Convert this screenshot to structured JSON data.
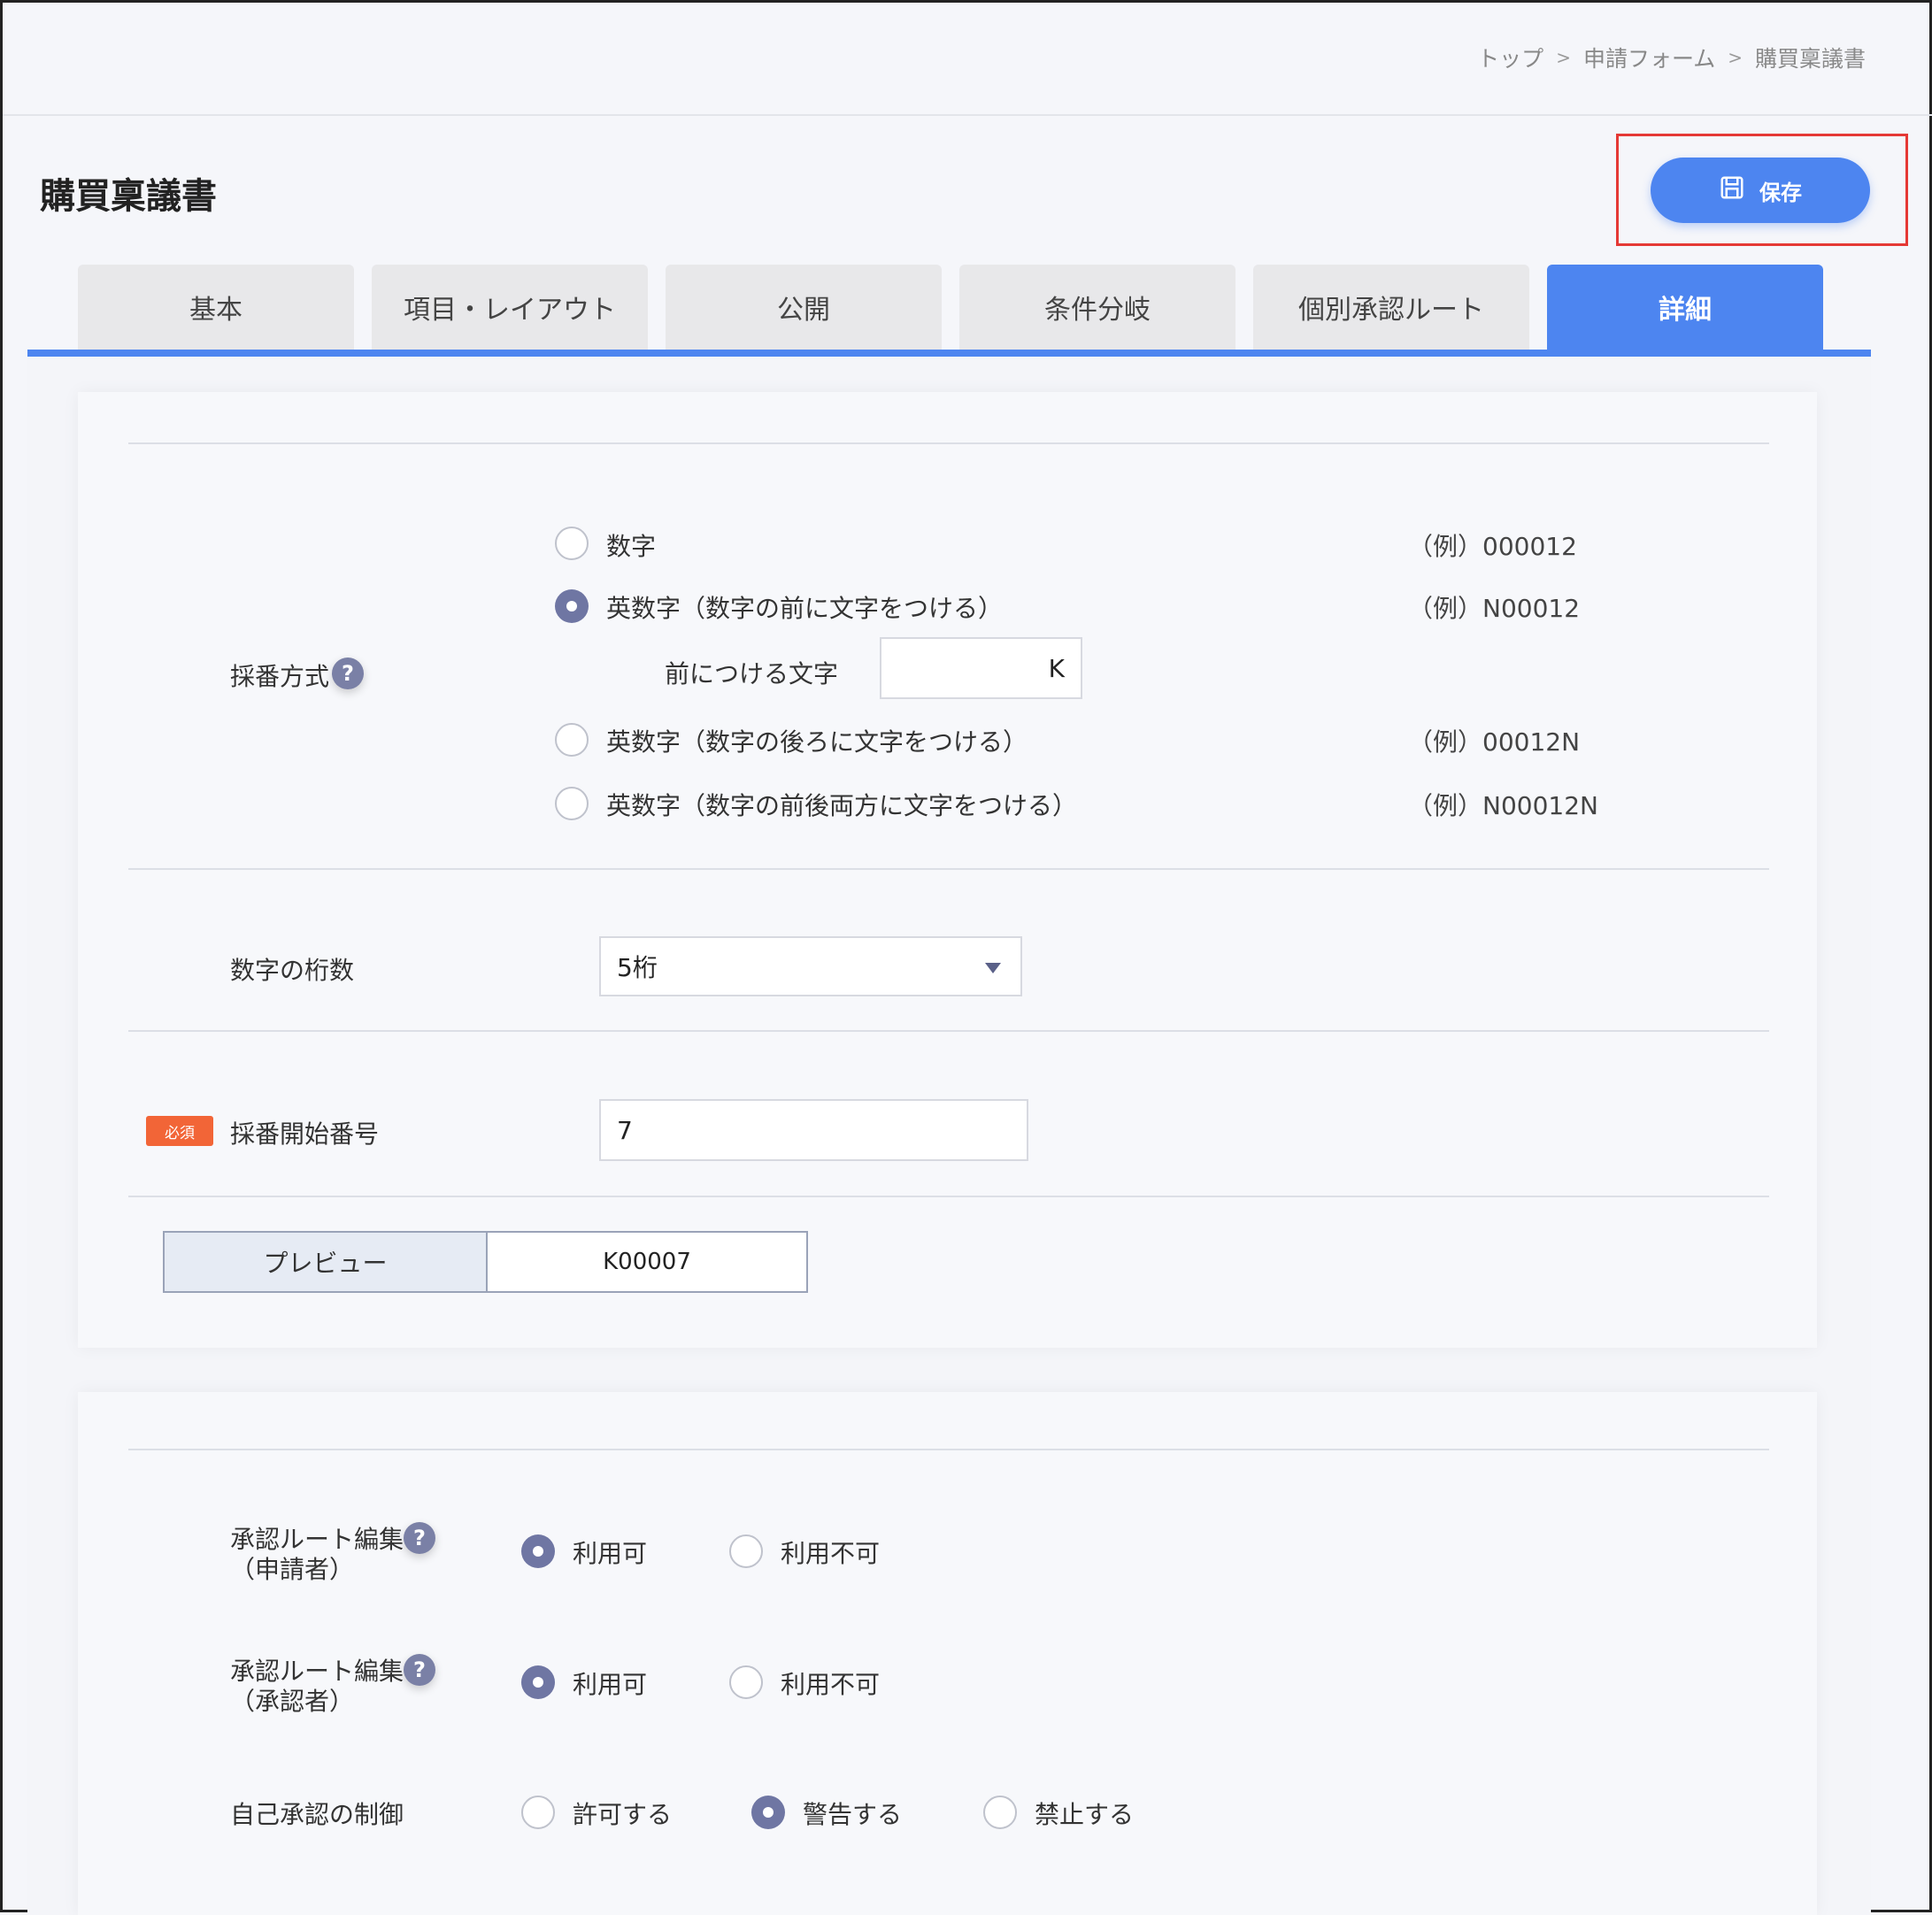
{
  "breadcrumb": {
    "items": [
      "トップ",
      "申請フォーム",
      "購買稟議書"
    ],
    "separator": ">"
  },
  "page": {
    "title": "購買稟議書"
  },
  "toolbar": {
    "save_label": "保存"
  },
  "tabs": [
    {
      "label": "基本",
      "active": false
    },
    {
      "label": "項目・レイアウト",
      "active": false
    },
    {
      "label": "公開",
      "active": false
    },
    {
      "label": "条件分岐",
      "active": false
    },
    {
      "label": "個別承認ルート",
      "active": false
    },
    {
      "label": "詳細",
      "active": true
    }
  ],
  "numbering": {
    "method_label": "採番方式",
    "help": "?",
    "options": [
      {
        "label": "数字",
        "example": "（例）000012",
        "selected": false
      },
      {
        "label": "英数字（数字の前に文字をつける）",
        "example": "（例）N00012",
        "selected": true
      },
      {
        "label": "英数字（数字の後ろに文字をつける）",
        "example": "（例）00012N",
        "selected": false
      },
      {
        "label": "英数字（数字の前後両方に文字をつける）",
        "example": "（例）N00012N",
        "selected": false
      }
    ],
    "prefix_label": "前につける文字",
    "prefix_value": "K",
    "digits_label": "数字の桁数",
    "digits_value": "5桁",
    "required_badge": "必須",
    "start_label": "採番開始番号",
    "start_value": "7",
    "preview_label": "プレビュー",
    "preview_value": "K00007"
  },
  "approval": {
    "route_edit_applicant": {
      "label_line1": "承認ルート編集",
      "label_line2": "（申請者）",
      "help": "?",
      "options": [
        {
          "label": "利用可",
          "selected": true
        },
        {
          "label": "利用不可",
          "selected": false
        }
      ]
    },
    "route_edit_approver": {
      "label_line1": "承認ルート編集",
      "label_line2": "（承認者）",
      "help": "?",
      "options": [
        {
          "label": "利用可",
          "selected": true
        },
        {
          "label": "利用不可",
          "selected": false
        }
      ]
    },
    "self_approval": {
      "label": "自己承認の制御",
      "options": [
        {
          "label": "許可する",
          "selected": false
        },
        {
          "label": "警告する",
          "selected": true
        },
        {
          "label": "禁止する",
          "selected": false
        }
      ]
    }
  },
  "colors": {
    "accent": "#4d85f0",
    "radio_selected": "#6f76a3",
    "required": "#f26537",
    "highlight": "#e53935"
  }
}
